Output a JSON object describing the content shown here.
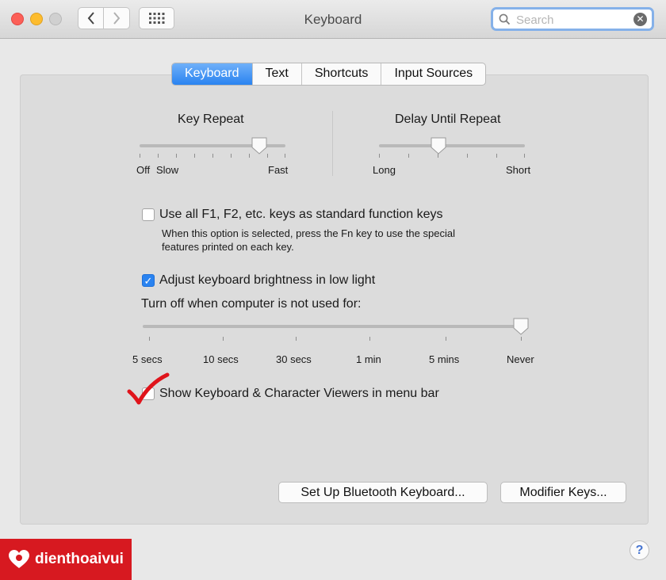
{
  "window": {
    "title": "Keyboard",
    "search_placeholder": "Search",
    "clear_icon": "✕"
  },
  "tabs": [
    {
      "label": "Keyboard",
      "active": true
    },
    {
      "label": "Text",
      "active": false
    },
    {
      "label": "Shortcuts",
      "active": false
    },
    {
      "label": "Input Sources",
      "active": false
    }
  ],
  "key_repeat": {
    "title": "Key Repeat",
    "min_label": "Off",
    "slow_label": "Slow",
    "max_label": "Fast",
    "level": 0.8
  },
  "delay_until_repeat": {
    "title": "Delay Until Repeat",
    "min_label": "Long",
    "max_label": "Short",
    "level": 0.4
  },
  "function_keys": {
    "label": "Use all F1, F2, etc. keys as standard function keys",
    "description_line1": "When this option is selected, press the Fn key to use the special",
    "description_line2": "features printed on each key.",
    "checked": false
  },
  "brightness": {
    "label": "Adjust keyboard brightness in low light",
    "checked": true,
    "check_glyph": "✓"
  },
  "turn_off": {
    "label": "Turn off when computer is not used for:",
    "stops": [
      "5 secs",
      "10 secs",
      "30 secs",
      "1 min",
      "5 mins",
      "Never"
    ],
    "selected": "Never"
  },
  "viewers": {
    "label": "Show Keyboard & Character Viewers in menu bar",
    "checked": false
  },
  "buttons": {
    "bluetooth": "Set Up Bluetooth Keyboard...",
    "modifier": "Modifier Keys...",
    "help": "?"
  },
  "watermark": {
    "text": "dienthoaivui",
    "color": "#d71920"
  },
  "colors": {
    "accent": "#2a83f0",
    "annotation": "#e0141b"
  }
}
